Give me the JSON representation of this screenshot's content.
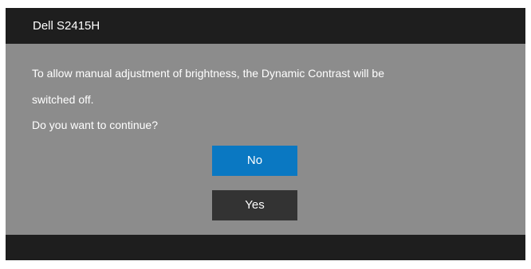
{
  "dialog": {
    "title": "Dell S2415H",
    "message_line_1": "To allow manual adjustment of brightness, the Dynamic Contrast will be",
    "message_line_2": "switched off.",
    "question": "Do you want to continue?",
    "buttons": {
      "no_label": "No",
      "yes_label": "Yes"
    }
  },
  "colors": {
    "header_bg": "#1e1e1e",
    "body_bg": "#8c8c8c",
    "selected_button": "#0a78c2",
    "unselected_button": "#333333",
    "text": "#ffffff"
  }
}
